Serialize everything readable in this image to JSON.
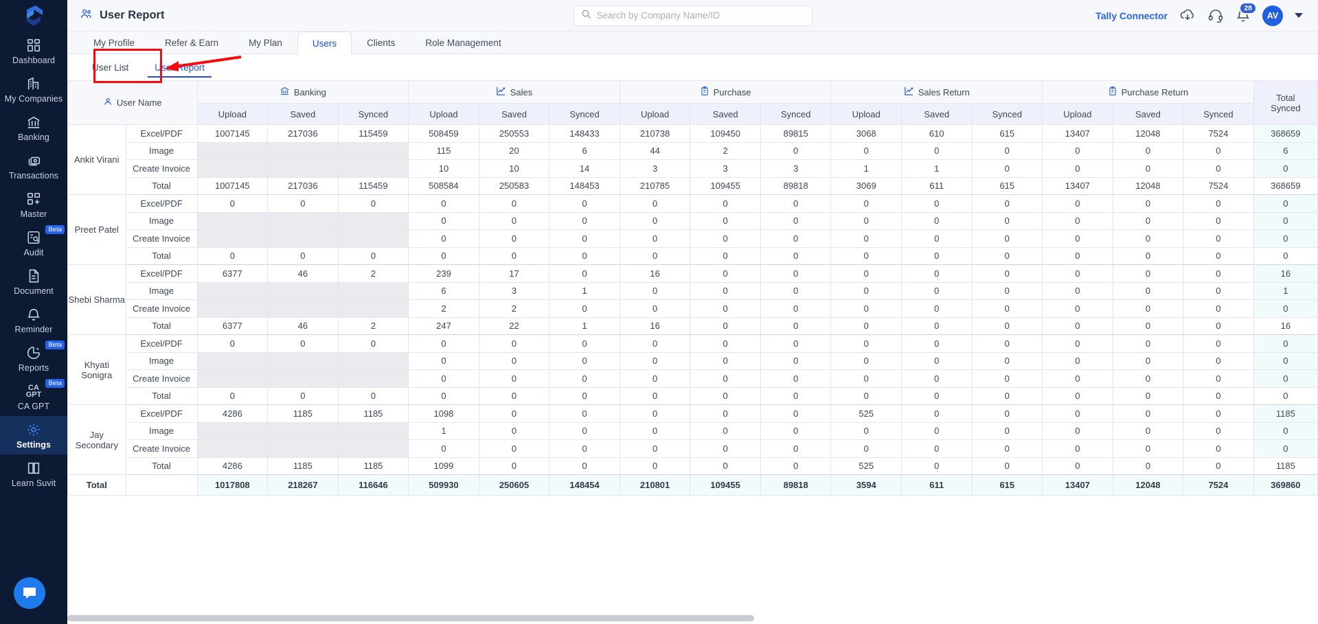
{
  "sidebar": {
    "logo": "suvit-logo",
    "items": [
      {
        "label": "Dashboard",
        "icon": "dashboard-icon",
        "beta": false,
        "active": false
      },
      {
        "label": "My Companies",
        "icon": "companies-icon",
        "beta": false,
        "active": false
      },
      {
        "label": "Banking",
        "icon": "bank-icon",
        "beta": false,
        "active": false
      },
      {
        "label": "Transactions",
        "icon": "transactions-icon",
        "beta": false,
        "active": false
      },
      {
        "label": "Master",
        "icon": "master-icon",
        "beta": false,
        "active": false
      },
      {
        "label": "Audit",
        "icon": "audit-icon",
        "beta": true,
        "beta_label": "Beta",
        "active": false
      },
      {
        "label": "Document",
        "icon": "document-icon",
        "beta": false,
        "active": false
      },
      {
        "label": "Reminder",
        "icon": "bell-icon",
        "beta": false,
        "active": false
      },
      {
        "label": "Reports",
        "icon": "pie-chart-icon",
        "beta": true,
        "beta_label": "Beta",
        "active": false
      },
      {
        "label": "CA GPT",
        "icon": "ca-gpt-icon",
        "beta": true,
        "beta_label": "Beta",
        "active": false
      },
      {
        "label": "Settings",
        "icon": "gear-icon",
        "beta": false,
        "active": true
      },
      {
        "label": "Learn Suvit",
        "icon": "book-icon",
        "beta": false,
        "active": false
      }
    ],
    "chat_button": "chat-bubble-icon"
  },
  "header": {
    "title": "User Report",
    "title_icon": "users-icon",
    "search": {
      "placeholder": "Search by Company Name/ID",
      "value": "",
      "icon": "search-icon"
    },
    "tally_connector": "Tally Connector",
    "download_icon": "cloud-download-icon",
    "support_icon": "headset-icon",
    "notification_icon": "bell-icon",
    "notification_count": "28",
    "avatar_initials": "AV",
    "caret_icon": "chevron-down-icon"
  },
  "tabs": [
    {
      "label": "My Profile",
      "active": false
    },
    {
      "label": "Refer & Earn",
      "active": false
    },
    {
      "label": "My Plan",
      "active": false
    },
    {
      "label": "Users",
      "active": true
    },
    {
      "label": "Clients",
      "active": false
    },
    {
      "label": "Role Management",
      "active": false
    }
  ],
  "subtabs": [
    {
      "label": "User List",
      "active": false
    },
    {
      "label": "User Report",
      "active": true
    }
  ],
  "annotation": {
    "type": "red-box-arrow",
    "target": "User Report",
    "color": "#f60b0b"
  },
  "table": {
    "user_name_header": "User Name",
    "user_name_icon": "user-icon",
    "total_synced_header": "Total\nSynced",
    "groups": [
      {
        "label": "Banking",
        "icon": "bank-icon"
      },
      {
        "label": "Sales",
        "icon": "chart-line-icon"
      },
      {
        "label": "Purchase",
        "icon": "clipboard-icon"
      },
      {
        "label": "Sales Return",
        "icon": "chart-line-icon"
      },
      {
        "label": "Purchase Return",
        "icon": "clipboard-icon"
      }
    ],
    "sub_headers": [
      "Upload",
      "Saved",
      "Synced"
    ],
    "row_labels": [
      "Excel/PDF",
      "Image",
      "Create Invoice",
      "Total"
    ],
    "grand_total_label": "Total",
    "users": [
      {
        "name": "Ankit Virani",
        "rows": [
          {
            "label": "Excel/PDF",
            "banking": [
              "1007145",
              "217036",
              "115459"
            ],
            "banking_disabled": false,
            "sales": [
              "508459",
              "250553",
              "148433"
            ],
            "purchase": [
              "210738",
              "109450",
              "89815"
            ],
            "sales_return": [
              "3068",
              "610",
              "615"
            ],
            "purchase_return": [
              "13407",
              "12048",
              "7524"
            ],
            "total_synced": "368659"
          },
          {
            "label": "Image",
            "banking": [
              "",
              "",
              ""
            ],
            "banking_disabled": true,
            "sales": [
              "115",
              "20",
              "6"
            ],
            "purchase": [
              "44",
              "2",
              "0"
            ],
            "sales_return": [
              "0",
              "0",
              "0"
            ],
            "purchase_return": [
              "0",
              "0",
              "0"
            ],
            "total_synced": "6"
          },
          {
            "label": "Create Invoice",
            "banking": [
              "",
              "",
              ""
            ],
            "banking_disabled": true,
            "sales": [
              "10",
              "10",
              "14"
            ],
            "purchase": [
              "3",
              "3",
              "3"
            ],
            "sales_return": [
              "1",
              "1",
              "0"
            ],
            "purchase_return": [
              "0",
              "0",
              "0"
            ],
            "total_synced": "0"
          },
          {
            "label": "Total",
            "banking": [
              "1007145",
              "217036",
              "115459"
            ],
            "banking_disabled": false,
            "sales": [
              "508584",
              "250583",
              "148453"
            ],
            "purchase": [
              "210785",
              "109455",
              "89818"
            ],
            "sales_return": [
              "3069",
              "611",
              "615"
            ],
            "purchase_return": [
              "13407",
              "12048",
              "7524"
            ],
            "total_synced": "368659"
          }
        ]
      },
      {
        "name": "Preet Patel",
        "rows": [
          {
            "label": "Excel/PDF",
            "banking": [
              "0",
              "0",
              "0"
            ],
            "banking_disabled": false,
            "sales": [
              "0",
              "0",
              "0"
            ],
            "purchase": [
              "0",
              "0",
              "0"
            ],
            "sales_return": [
              "0",
              "0",
              "0"
            ],
            "purchase_return": [
              "0",
              "0",
              "0"
            ],
            "total_synced": "0"
          },
          {
            "label": "Image",
            "banking": [
              "",
              "",
              ""
            ],
            "banking_disabled": true,
            "sales": [
              "0",
              "0",
              "0"
            ],
            "purchase": [
              "0",
              "0",
              "0"
            ],
            "sales_return": [
              "0",
              "0",
              "0"
            ],
            "purchase_return": [
              "0",
              "0",
              "0"
            ],
            "total_synced": "0"
          },
          {
            "label": "Create Invoice",
            "banking": [
              "",
              "",
              ""
            ],
            "banking_disabled": true,
            "sales": [
              "0",
              "0",
              "0"
            ],
            "purchase": [
              "0",
              "0",
              "0"
            ],
            "sales_return": [
              "0",
              "0",
              "0"
            ],
            "purchase_return": [
              "0",
              "0",
              "0"
            ],
            "total_synced": "0"
          },
          {
            "label": "Total",
            "banking": [
              "0",
              "0",
              "0"
            ],
            "banking_disabled": false,
            "sales": [
              "0",
              "0",
              "0"
            ],
            "purchase": [
              "0",
              "0",
              "0"
            ],
            "sales_return": [
              "0",
              "0",
              "0"
            ],
            "purchase_return": [
              "0",
              "0",
              "0"
            ],
            "total_synced": "0"
          }
        ]
      },
      {
        "name": "Shebi Sharma",
        "rows": [
          {
            "label": "Excel/PDF",
            "banking": [
              "6377",
              "46",
              "2"
            ],
            "banking_disabled": false,
            "sales": [
              "239",
              "17",
              "0"
            ],
            "purchase": [
              "16",
              "0",
              "0"
            ],
            "sales_return": [
              "0",
              "0",
              "0"
            ],
            "purchase_return": [
              "0",
              "0",
              "0"
            ],
            "total_synced": "16"
          },
          {
            "label": "Image",
            "banking": [
              "",
              "",
              ""
            ],
            "banking_disabled": true,
            "sales": [
              "6",
              "3",
              "1"
            ],
            "purchase": [
              "0",
              "0",
              "0"
            ],
            "sales_return": [
              "0",
              "0",
              "0"
            ],
            "purchase_return": [
              "0",
              "0",
              "0"
            ],
            "total_synced": "1"
          },
          {
            "label": "Create Invoice",
            "banking": [
              "",
              "",
              ""
            ],
            "banking_disabled": true,
            "sales": [
              "2",
              "2",
              "0"
            ],
            "purchase": [
              "0",
              "0",
              "0"
            ],
            "sales_return": [
              "0",
              "0",
              "0"
            ],
            "purchase_return": [
              "0",
              "0",
              "0"
            ],
            "total_synced": "0"
          },
          {
            "label": "Total",
            "banking": [
              "6377",
              "46",
              "2"
            ],
            "banking_disabled": false,
            "sales": [
              "247",
              "22",
              "1"
            ],
            "purchase": [
              "16",
              "0",
              "0"
            ],
            "sales_return": [
              "0",
              "0",
              "0"
            ],
            "purchase_return": [
              "0",
              "0",
              "0"
            ],
            "total_synced": "16"
          }
        ]
      },
      {
        "name": "Khyati Sonigra",
        "rows": [
          {
            "label": "Excel/PDF",
            "banking": [
              "0",
              "0",
              "0"
            ],
            "banking_disabled": false,
            "sales": [
              "0",
              "0",
              "0"
            ],
            "purchase": [
              "0",
              "0",
              "0"
            ],
            "sales_return": [
              "0",
              "0",
              "0"
            ],
            "purchase_return": [
              "0",
              "0",
              "0"
            ],
            "total_synced": "0"
          },
          {
            "label": "Image",
            "banking": [
              "",
              "",
              ""
            ],
            "banking_disabled": true,
            "sales": [
              "0",
              "0",
              "0"
            ],
            "purchase": [
              "0",
              "0",
              "0"
            ],
            "sales_return": [
              "0",
              "0",
              "0"
            ],
            "purchase_return": [
              "0",
              "0",
              "0"
            ],
            "total_synced": "0"
          },
          {
            "label": "Create Invoice",
            "banking": [
              "",
              "",
              ""
            ],
            "banking_disabled": true,
            "sales": [
              "0",
              "0",
              "0"
            ],
            "purchase": [
              "0",
              "0",
              "0"
            ],
            "sales_return": [
              "0",
              "0",
              "0"
            ],
            "purchase_return": [
              "0",
              "0",
              "0"
            ],
            "total_synced": "0"
          },
          {
            "label": "Total",
            "banking": [
              "0",
              "0",
              "0"
            ],
            "banking_disabled": false,
            "sales": [
              "0",
              "0",
              "0"
            ],
            "purchase": [
              "0",
              "0",
              "0"
            ],
            "sales_return": [
              "0",
              "0",
              "0"
            ],
            "purchase_return": [
              "0",
              "0",
              "0"
            ],
            "total_synced": "0"
          }
        ]
      },
      {
        "name": "Jay Secondary",
        "rows": [
          {
            "label": "Excel/PDF",
            "banking": [
              "4286",
              "1185",
              "1185"
            ],
            "banking_disabled": false,
            "sales": [
              "1098",
              "0",
              "0"
            ],
            "purchase": [
              "0",
              "0",
              "0"
            ],
            "sales_return": [
              "525",
              "0",
              "0"
            ],
            "purchase_return": [
              "0",
              "0",
              "0"
            ],
            "total_synced": "1185"
          },
          {
            "label": "Image",
            "banking": [
              "",
              "",
              ""
            ],
            "banking_disabled": true,
            "sales": [
              "1",
              "0",
              "0"
            ],
            "purchase": [
              "0",
              "0",
              "0"
            ],
            "sales_return": [
              "0",
              "0",
              "0"
            ],
            "purchase_return": [
              "0",
              "0",
              "0"
            ],
            "total_synced": "0"
          },
          {
            "label": "Create Invoice",
            "banking": [
              "",
              "",
              ""
            ],
            "banking_disabled": true,
            "sales": [
              "0",
              "0",
              "0"
            ],
            "purchase": [
              "0",
              "0",
              "0"
            ],
            "sales_return": [
              "0",
              "0",
              "0"
            ],
            "purchase_return": [
              "0",
              "0",
              "0"
            ],
            "total_synced": "0"
          },
          {
            "label": "Total",
            "banking": [
              "4286",
              "1185",
              "1185"
            ],
            "banking_disabled": false,
            "sales": [
              "1099",
              "0",
              "0"
            ],
            "purchase": [
              "0",
              "0",
              "0"
            ],
            "sales_return": [
              "525",
              "0",
              "0"
            ],
            "purchase_return": [
              "0",
              "0",
              "0"
            ],
            "total_synced": "1185"
          }
        ]
      }
    ],
    "grand_total": {
      "label": "Total",
      "banking": [
        "1017808",
        "218267",
        "116646"
      ],
      "sales": [
        "509930",
        "250605",
        "148454"
      ],
      "purchase": [
        "210801",
        "109455",
        "89818"
      ],
      "sales_return": [
        "3594",
        "611",
        "615"
      ],
      "purchase_return": [
        "13407",
        "12048",
        "7524"
      ],
      "total_synced": "369860"
    }
  },
  "colors": {
    "sidebar_bg": "#0d1a33",
    "accent": "#1d4ed8",
    "annotation": "#f60b0b",
    "group_header_bg": "#f7f8fb",
    "sub_header_bg": "#eef1fb",
    "total_col_bg": "#f2fbfc",
    "disabled_cell_bg": "#e9ebef"
  }
}
